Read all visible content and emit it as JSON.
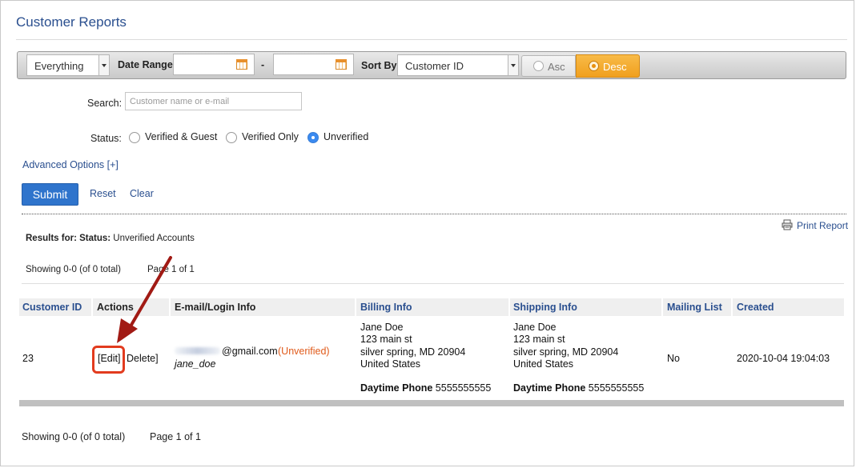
{
  "page": {
    "title": "Customer Reports"
  },
  "toolbar": {
    "filter_value": "Everything",
    "date_range_label": "Date Range",
    "date_from_value": "",
    "date_separator": "-",
    "date_to_value": "",
    "sort_by_label": "Sort By",
    "sort_by_value": "Customer ID",
    "asc_label": "Asc",
    "desc_label": "Desc",
    "selected_order": "Desc"
  },
  "search": {
    "label": "Search:",
    "placeholder": "Customer name or e-mail",
    "value": ""
  },
  "status": {
    "label": "Status:",
    "options": [
      "Verified & Guest",
      "Verified Only",
      "Unverified"
    ],
    "selected": "Unverified"
  },
  "advanced_options": "Advanced Options [+]",
  "buttons": {
    "submit": "Submit",
    "reset": "Reset",
    "clear": "Clear"
  },
  "print_report": "Print Report",
  "results": {
    "prefix": "Results for:",
    "status_label": "Status:",
    "status_value": "Unverified Accounts",
    "showing_top": "Showing 0-0 (of 0 total)",
    "page_top": "Page 1 of 1",
    "showing_bottom": "Showing 0-0 (of 0 total)",
    "page_bottom": "Page 1 of 1"
  },
  "table": {
    "headers": [
      "Customer ID",
      "Actions",
      "E-mail/Login Info",
      "Billing Info",
      "Shipping Info",
      "Mailing List",
      "Created"
    ],
    "rows": [
      {
        "customer_id": "23",
        "edit": "[Edit]",
        "delete": "Delete]",
        "email_suffix": "@gmail.com",
        "email_status": "(Unverified)",
        "login": "jane_doe",
        "billing": {
          "name": "Jane Doe",
          "street": "123 main st",
          "city": "silver spring, MD 20904",
          "country": "United States",
          "phone_label": "Daytime Phone",
          "phone": "5555555555"
        },
        "shipping": {
          "name": "Jane Doe",
          "street": "123 main st",
          "city": "silver spring, MD 20904",
          "country": "United States",
          "phone_label": "Daytime Phone",
          "phone": "5555555555"
        },
        "mailing_list": "No",
        "created": "2020-10-04 19:04:03"
      }
    ]
  },
  "colors": {
    "link": "#2a4f8f",
    "accent_orange": "#f0a01e",
    "unverified": "#e05a1a",
    "highlight": "#e23b1e",
    "arrow": "#a11a14"
  }
}
